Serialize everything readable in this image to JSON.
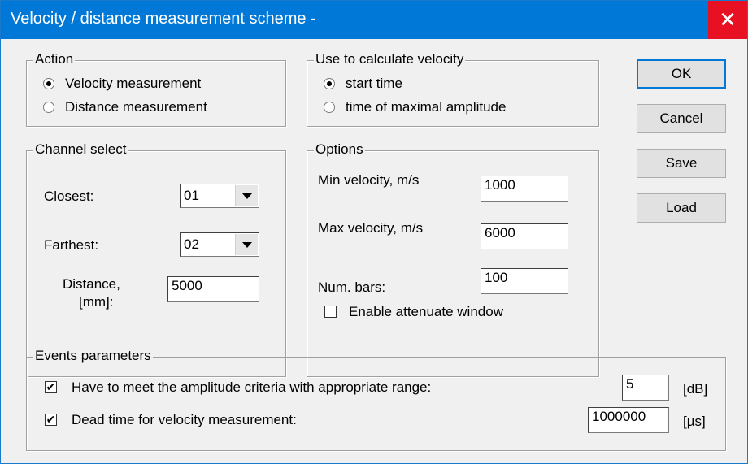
{
  "window": {
    "title": "Velocity / distance measurement scheme -",
    "close_symbol": "✕"
  },
  "action": {
    "legend": "Action",
    "options": [
      "Velocity measurement",
      "Distance measurement"
    ],
    "selected": 0
  },
  "velocity_calc": {
    "legend": "Use to calculate velocity",
    "options": [
      "start time",
      "time of maximal amplitude"
    ],
    "selected": 0
  },
  "buttons": {
    "ok": "OK",
    "cancel": "Cancel",
    "save": "Save",
    "load": "Load"
  },
  "channel": {
    "legend": "Channel select",
    "closest_label": "Closest:",
    "closest_value": "01",
    "farthest_label": "Farthest:",
    "farthest_value": "02",
    "distance_label_1": "Distance,",
    "distance_label_2": "[mm]:",
    "distance_value": "5000"
  },
  "options": {
    "legend": "Options",
    "min_velocity_label": "Min velocity, m/s",
    "min_velocity_value": "1000",
    "max_velocity_label": "Max velocity, m/s",
    "max_velocity_value": "6000",
    "num_bars_label": "Num. bars:",
    "num_bars_value": "100",
    "attenuate_label": "Enable attenuate window",
    "attenuate_checked": false
  },
  "events": {
    "legend": "Events parameters",
    "amplitude_label": "Have to meet the amplitude criteria with appropriate range:",
    "amplitude_checked": true,
    "amplitude_value": "5",
    "amplitude_unit": "[dB]",
    "deadtime_label": "Dead time for velocity measurement:",
    "deadtime_checked": true,
    "deadtime_value": "1000000",
    "deadtime_unit": "[µs]"
  },
  "colors": {
    "titlebar": "#0078d7",
    "close": "#e81123",
    "dialog_bg": "#f0f0f0"
  }
}
